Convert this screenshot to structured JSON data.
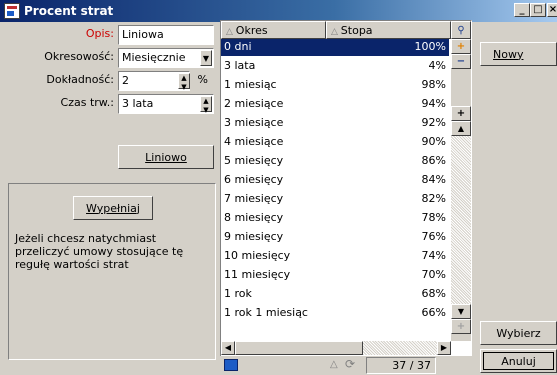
{
  "window": {
    "title": "Procent strat"
  },
  "form": {
    "opis_label": "Opis:",
    "opis_value": "Liniowa",
    "okresowosc_label": "Okresowość:",
    "okresowosc_value": "Miesięcznie",
    "dokladnosc_label": "Dokładność:",
    "dokladnosc_value": "2",
    "dokladnosc_unit": "%",
    "czas_label": "Czas trw.:",
    "czas_value": "3 lata",
    "liniowo_button": "Liniowo"
  },
  "fill_box": {
    "button": "Wypełniaj",
    "description": "Jeżeli chcesz natychmiast przeliczyć umowy stosujące tę regułę wartości strat"
  },
  "grid": {
    "columns": [
      "Okres",
      "Stopa"
    ],
    "rows": [
      {
        "okres": "0 dni",
        "stopa": "100%"
      },
      {
        "okres": "3 lata",
        "stopa": "4%"
      },
      {
        "okres": "1 miesiąc",
        "stopa": "98%"
      },
      {
        "okres": "2 miesiące",
        "stopa": "94%"
      },
      {
        "okres": "3 miesiące",
        "stopa": "92%"
      },
      {
        "okres": "4 miesiące",
        "stopa": "90%"
      },
      {
        "okres": "5 miesięcy",
        "stopa": "86%"
      },
      {
        "okres": "6 miesięcy",
        "stopa": "84%"
      },
      {
        "okres": "7 miesięcy",
        "stopa": "82%"
      },
      {
        "okres": "8 miesięcy",
        "stopa": "78%"
      },
      {
        "okres": "9 miesięcy",
        "stopa": "76%"
      },
      {
        "okres": "10 miesięcy",
        "stopa": "74%"
      },
      {
        "okres": "11 miesięcy",
        "stopa": "70%"
      },
      {
        "okres": "1 rok",
        "stopa": "68%"
      },
      {
        "okres": "1 rok 1 miesiąc",
        "stopa": "66%"
      }
    ],
    "selected_row": 0,
    "counter": "37 / 37"
  },
  "actions": {
    "nowy": "Nowy",
    "wybierz": "Wybierz",
    "anuluj": "Anuluj"
  },
  "colors": {
    "title_bar": "#0a246a",
    "selection": "#0a246a",
    "required_label": "#cc0000"
  }
}
